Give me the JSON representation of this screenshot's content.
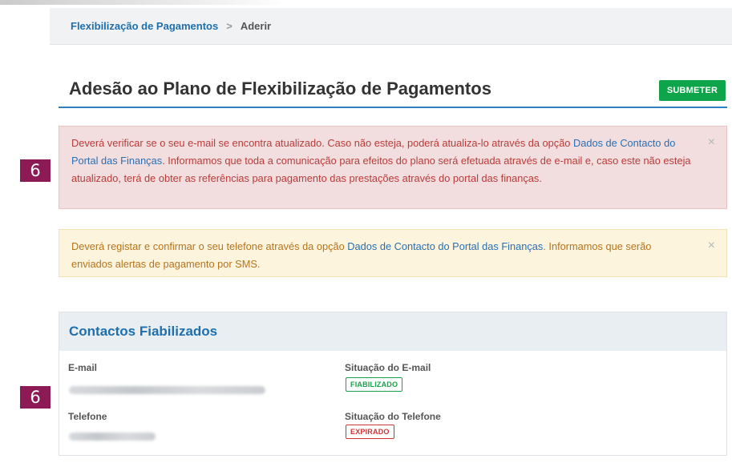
{
  "breadcrumb": {
    "link_label": "Flexibilização de Pagamentos",
    "separator": ">",
    "current_label": "Aderir"
  },
  "page": {
    "title": "Adesão ao Plano de Flexibilização de Pagamentos",
    "submit_label": "SUBMETER"
  },
  "step_badges": [
    "6",
    "6"
  ],
  "alerts": {
    "email": {
      "text_before": "Deverá verificar se o seu e-mail se encontra atualizado. Caso não esteja, poderá atualiza-lo através da opção ",
      "link": "Dados de Contacto do Portal das Finanças",
      "text_after": ". Informamos que toda a comunicação para efeitos do plano será efetuada através de e-mail e, caso este não esteja atualizado, terá de obter as referências para pagamento das prestações através do portal das finanças.",
      "close": "×"
    },
    "phone": {
      "text_before": "Deverá registar e confirmar o seu telefone através da opção ",
      "link": "Dados de Contacto do Portal das Finanças",
      "text_after": ". Informamos que serão enviados alertas de pagamento por SMS.",
      "close": "×"
    }
  },
  "contacts_panel": {
    "title": "Contactos Fiabilizados",
    "email_label": "E-mail",
    "email_status_label": "Situação do E-mail",
    "email_status": "FIABILIZADO",
    "phone_label": "Telefone",
    "phone_status_label": "Situação do Telefone",
    "phone_status": "EXPIRADO"
  },
  "colors": {
    "primary": "#1f6fad",
    "success": "#0ea44a",
    "danger": "#d03434",
    "badge": "#8b1a55"
  }
}
